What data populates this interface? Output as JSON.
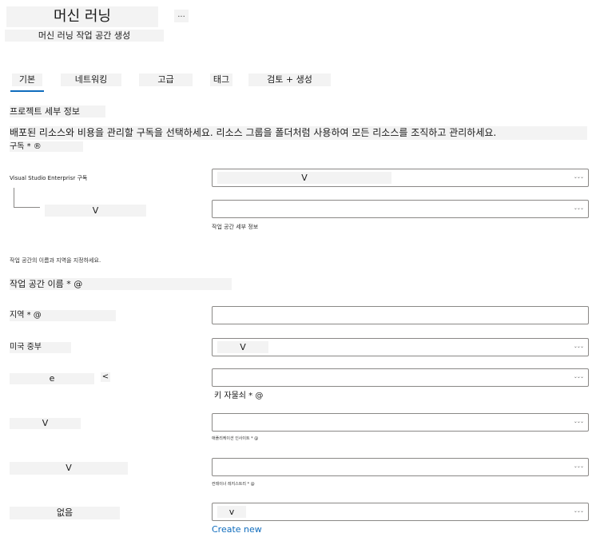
{
  "header": {
    "title": "머신 러닝",
    "more": "...",
    "subtitle": "머신 러닝 작업 공간 생성"
  },
  "tabs": [
    {
      "label": "기본"
    },
    {
      "label": "네트워킹"
    },
    {
      "label": "고급"
    },
    {
      "label": "태그"
    },
    {
      "label": "검토 + 생성"
    }
  ],
  "project": {
    "heading": "프로젝트 세부 정보",
    "description": "배포된 리소스와 비용을 관리할 구독을 선택하세요. 리소스 그룹을 폴더처럼 사용하여 모든 리소스를 조직하고 관리하세요.",
    "subscription_label": "구독 * ®",
    "subscription_name": "Visual Studio Enterprisr 구독",
    "subscription_value": "V",
    "resource_group_value": "V",
    "workspace_hint": "작업 공간 세부 정보"
  },
  "workspace": {
    "instruction": "작업 공간의 이름과 지역을 지정하세요.",
    "name_label": "작업 공간 이름 * @",
    "region_label": "지역 * @",
    "region_value": "미국 중부",
    "region_dropdown_value": "V",
    "storage_label": "e",
    "storage_icon": "<",
    "key_vault_label": "키 자물쇠 * @",
    "app_insights_label": "V",
    "app_insights_hint": "애플리케이션 인사이트 * @",
    "container_label": "V",
    "container_hint": "컨테이너 레지스트리 * @",
    "none_label": "없음",
    "none_value": "v",
    "create_new": "Create new"
  },
  "icons": {
    "dropdown": "chevron-down-icon",
    "more": "more-icon"
  },
  "colors": {
    "accent": "#0f6cbd",
    "border": "#8a8886",
    "highlight": "#f3f3f3"
  }
}
